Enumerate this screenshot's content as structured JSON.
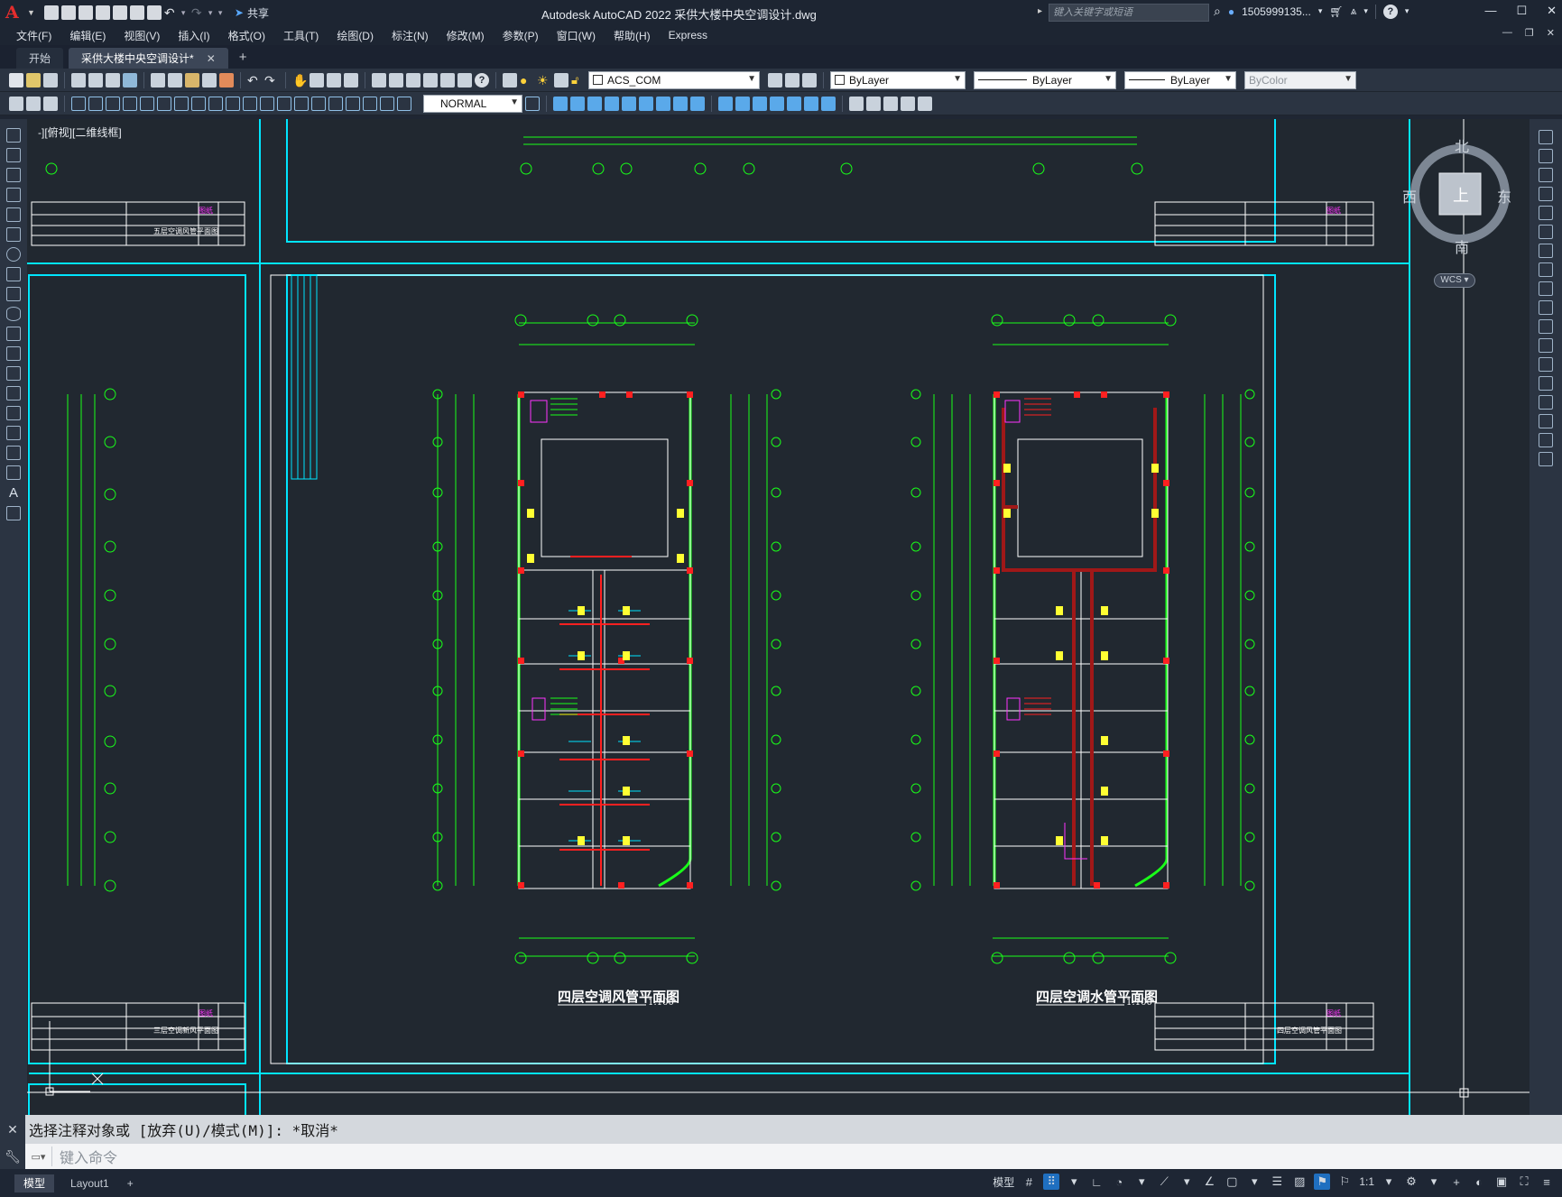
{
  "app": {
    "title": "Autodesk AutoCAD 2022    采供大楼中央空调设计.dwg",
    "logo": "A",
    "share": "共享",
    "search_placeholder": "键入关键字或短语",
    "user": "1505999135...",
    "window_controls": [
      "—",
      "☐",
      "✕"
    ]
  },
  "menu": [
    "文件(F)",
    "编辑(E)",
    "视图(V)",
    "插入(I)",
    "格式(O)",
    "工具(T)",
    "绘图(D)",
    "标注(N)",
    "修改(M)",
    "参数(P)",
    "窗口(W)",
    "帮助(H)",
    "Express"
  ],
  "tabs": [
    {
      "label": "开始"
    },
    {
      "label": "采供大楼中央空调设计*"
    }
  ],
  "toolbar": {
    "layer": "ACS_COM",
    "color": "ByLayer",
    "linetype": "ByLayer",
    "lineweight": "ByLayer",
    "plotstyle": "ByColor",
    "dimstyle": "NORMAL"
  },
  "viewport": {
    "label": "-][俯视][二维线框]"
  },
  "viewcube": {
    "north": "北",
    "south": "南",
    "east": "东",
    "west": "西",
    "top": "上",
    "wcs": "WCS"
  },
  "drawings": {
    "left_title": "四层空调风管平面图",
    "right_title": "四层空调水管平面图",
    "scale": "1:100",
    "title_block_texts": [
      "五层空调风管平面图",
      "三层空调新风平面图",
      "四层空调风管平面图"
    ]
  },
  "command": {
    "history": "选择注释对象或 [放弃(U)/模式(M)]: *取消*",
    "placeholder": "键入命令"
  },
  "status": {
    "tabs": [
      "模型",
      "Layout1"
    ],
    "model_label": "模型",
    "scale": "1:1"
  },
  "colors": {
    "cad_bg": "#212830",
    "green": "#19ff19",
    "cyan": "#00e5ff",
    "red": "#ff2020",
    "magenta": "#ff33ff",
    "yellow": "#ffff33"
  }
}
